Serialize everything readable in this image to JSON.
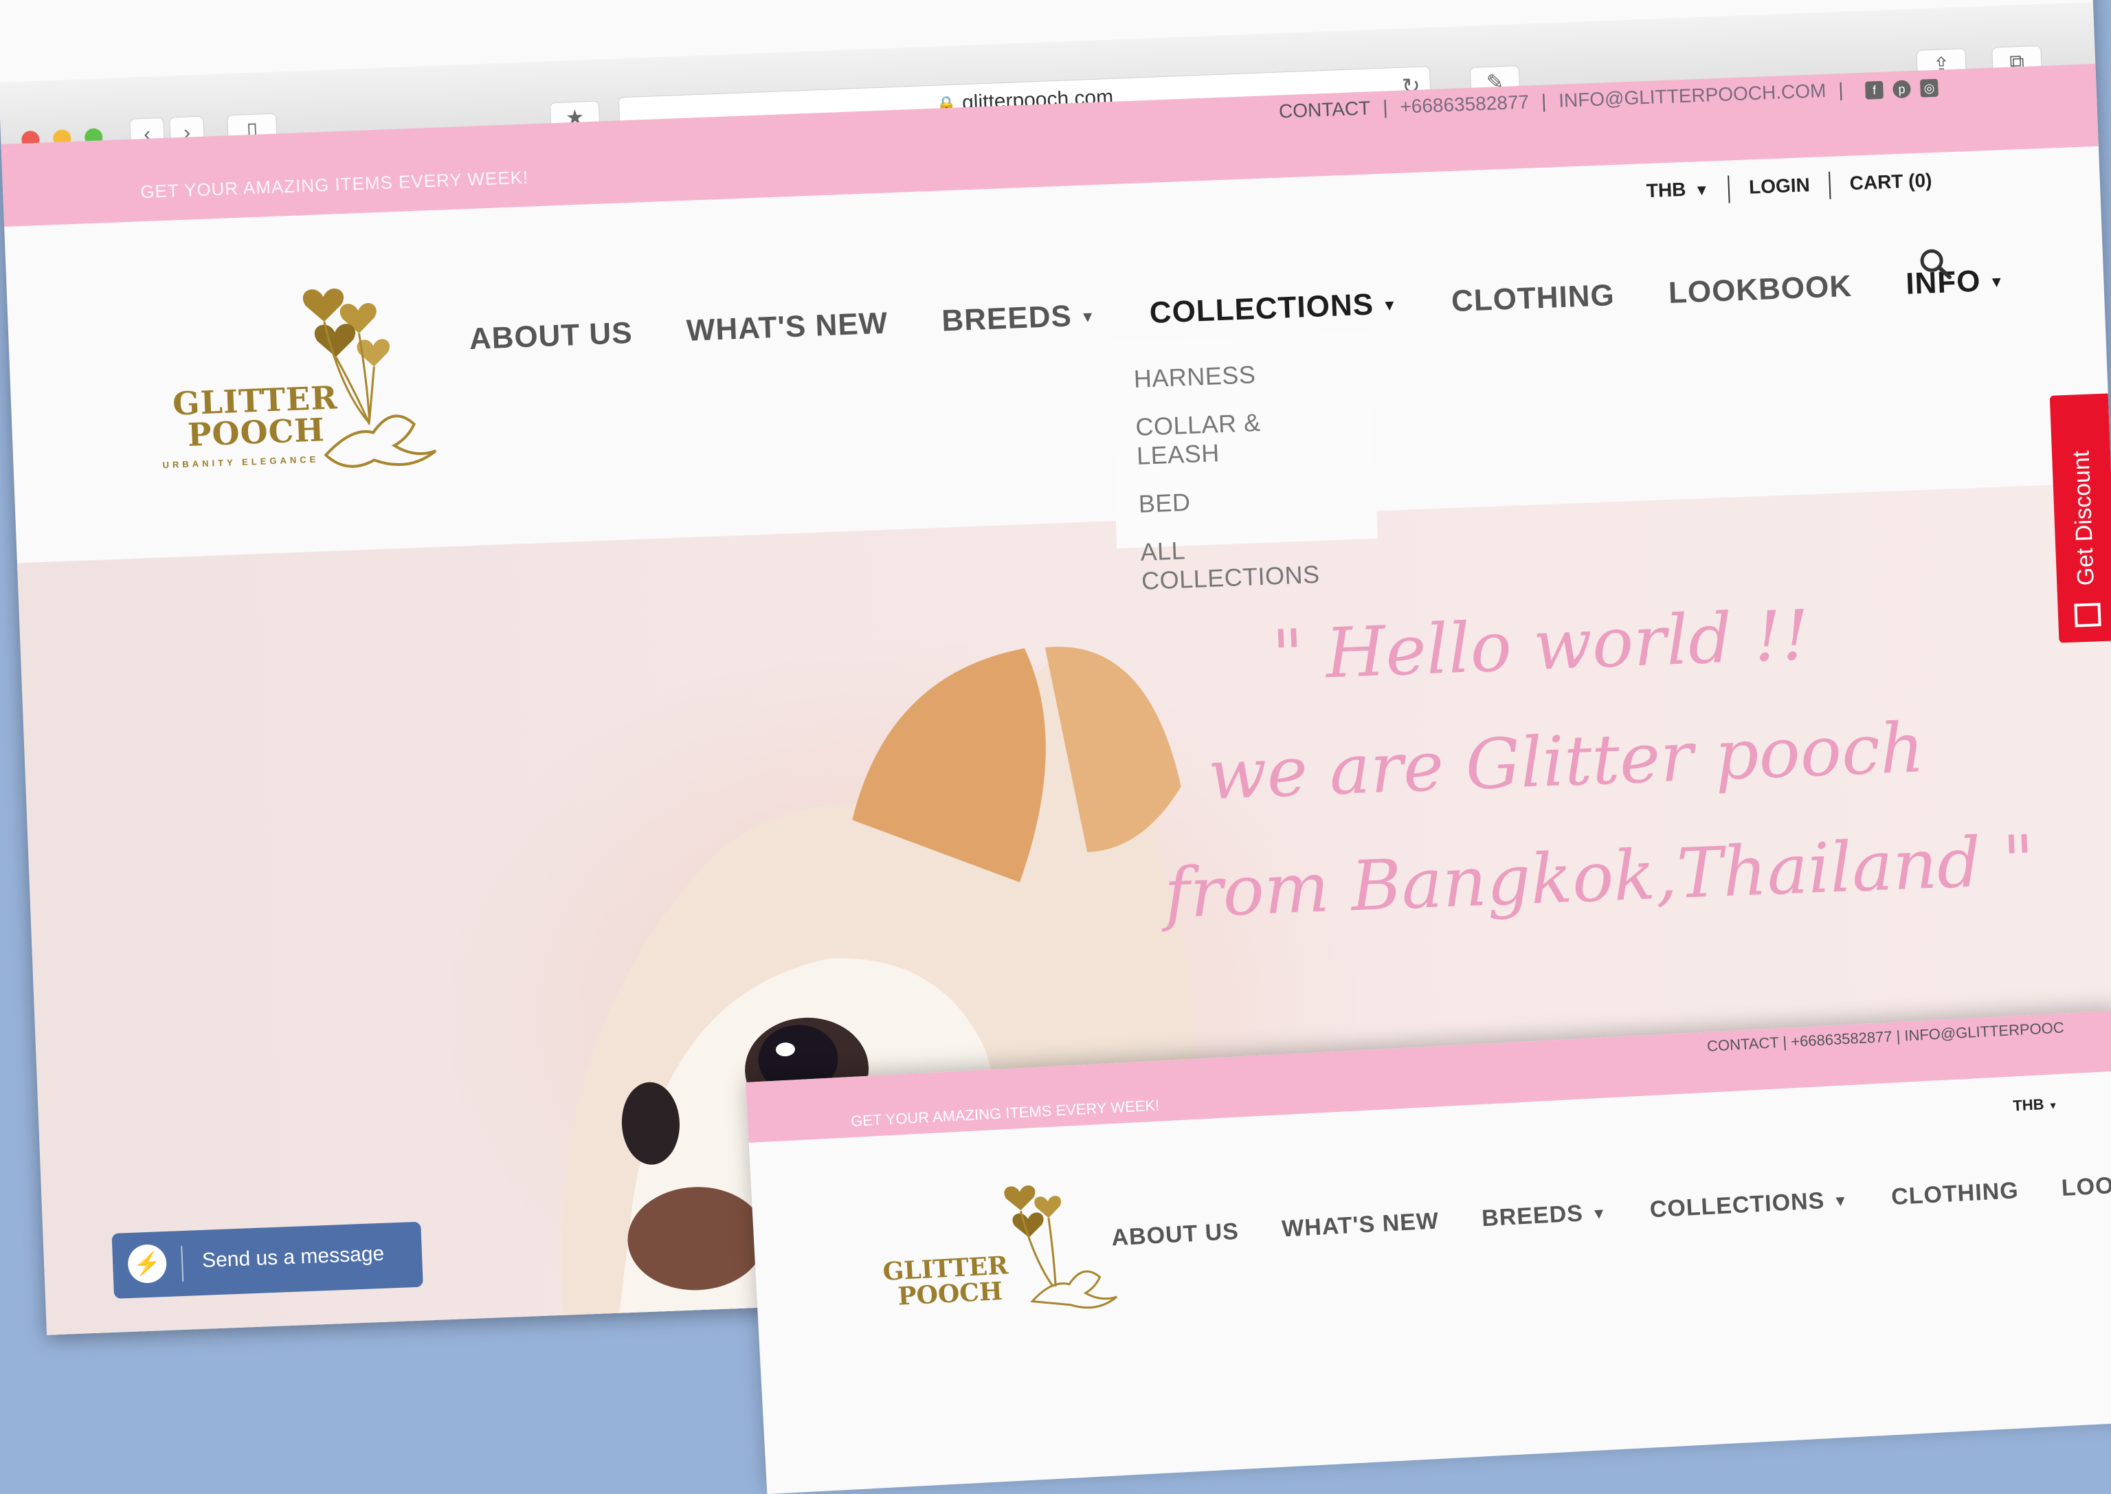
{
  "browser": {
    "url": "glitterpooch.com"
  },
  "topbar": {
    "promo": "GET YOUR AMAZING ITEMS EVERY WEEK!",
    "contact_label": "CONTACT",
    "phone": "+66863582877",
    "email": "INFO@GLITTERPOOCH.COM",
    "sep": "|"
  },
  "account": {
    "currency": "THB",
    "login": "LOGIN",
    "cart": "CART (0)"
  },
  "logo": {
    "line1": "GLITTER",
    "line2": "POOCH",
    "tagline": "URBANITY ELEGANCE"
  },
  "nav": {
    "items": [
      {
        "label": "ABOUT US"
      },
      {
        "label": "WHAT'S NEW"
      },
      {
        "label": "BREEDS"
      },
      {
        "label": "COLLECTIONS"
      },
      {
        "label": "CLOTHING"
      },
      {
        "label": "LOOKBOOK"
      },
      {
        "label": "INFO"
      }
    ]
  },
  "dropdown": {
    "items": [
      "HARNESS",
      "COLLAR & LEASH",
      "BED",
      "ALL COLLECTIONS"
    ]
  },
  "hero": {
    "quote_line1": "\" Hello world !!",
    "quote_line2": "we are Glitter pooch",
    "quote_line3": "from Bangkok,Thailand \""
  },
  "discount": {
    "label": "Get Discount"
  },
  "messenger": {
    "label": "Send us a message"
  },
  "second": {
    "promo": "GET YOUR AMAZING ITEMS EVERY WEEK!",
    "contact": "CONTACT  |  +66863582877  |  INFO@GLITTERPOOC",
    "currency": "THB",
    "logo1": "GLITTER",
    "logo2": "POOCH",
    "nav": [
      "ABOUT US",
      "WHAT'S NEW",
      "BREEDS",
      "COLLECTIONS",
      "CLOTHING",
      "LOOKBOOK"
    ]
  },
  "colors": {
    "topbar_pink": "#f5b5cf",
    "quote_pink": "#eb9ec0",
    "gold": "#9c7d2c",
    "discount_red": "#e8122a",
    "messenger_blue": "#4e6fa8",
    "desktop_blue": "#97b2d9"
  },
  "icons": [
    "back-icon",
    "forward-icon",
    "sidebar-icon",
    "bookmark-icon",
    "lock-icon",
    "reload-icon",
    "share-icon",
    "tabs-icon",
    "facebook-icon",
    "pinterest-icon",
    "instagram-icon",
    "search-icon",
    "gift-icon",
    "messenger-icon"
  ]
}
